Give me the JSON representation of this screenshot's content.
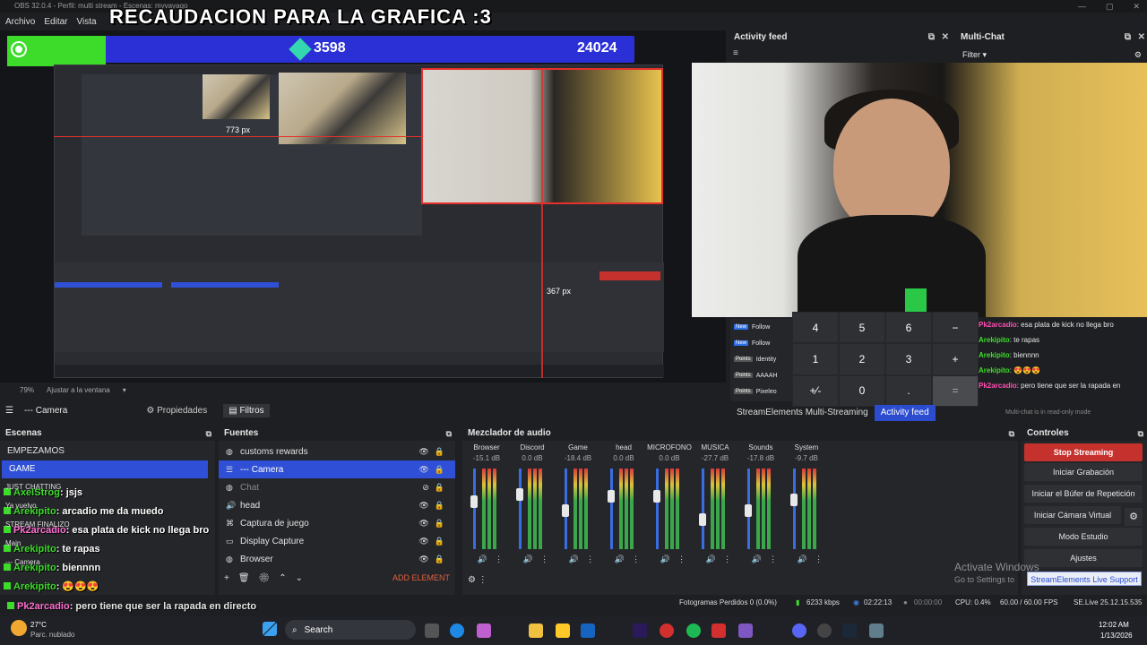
{
  "window": {
    "title": "OBS 32.0.4 - Perfil: multi stream - Escenas: myvayago",
    "btn_min": "—",
    "btn_max": "▢",
    "btn_close": "✕"
  },
  "menu": {
    "items": [
      "Archivo",
      "Editar",
      "Vista"
    ]
  },
  "overlay": {
    "title": "RECAUDACION PARA LA GRAFICA :3",
    "goal_current": "3598",
    "goal_target": "24024"
  },
  "preview": {
    "dim_width": "773 px",
    "dim_height": "367 px",
    "zoom": "79%",
    "fit_label": "Ajustar a la ventana"
  },
  "activity_feed": {
    "title": "Activity feed",
    "rows": [
      {
        "tag": "New",
        "label": "Follow"
      },
      {
        "tag": "New",
        "label": "Follow"
      },
      {
        "tag": "Points",
        "label": "Identity"
      },
      {
        "tag": "Points",
        "label": "AAAAH"
      },
      {
        "tag": "Points",
        "label": "Pixeleo"
      }
    ],
    "tabs": [
      "StreamElements Multi-Streaming",
      "Activity feed"
    ]
  },
  "multichat": {
    "title": "Multi-Chat",
    "filter": "Filter",
    "messages": [
      {
        "user": "Pk2arcadio",
        "text": "esa plata de kick no llega bro",
        "color": "p"
      },
      {
        "user": "Arekipito",
        "text": "te rapas",
        "color": "g"
      },
      {
        "user": "Arekipito",
        "text": "biennnn",
        "color": "g"
      },
      {
        "user": "Arekipito",
        "text": "😍😍😍",
        "color": "g"
      },
      {
        "user": "Pk2arcadio",
        "text": "pero tiene que ser la rapada en",
        "color": "p"
      }
    ],
    "readonly": "Multi-chat is in read-only mode"
  },
  "keypad": {
    "keys": [
      "4",
      "5",
      "6",
      "−",
      "1",
      "2",
      "3",
      "+",
      "+⁄-",
      "0",
      ".",
      "="
    ]
  },
  "source_bar": {
    "source": "--- Camera",
    "props": "Propiedades",
    "filters": "Filtros"
  },
  "scenes": {
    "title": "Escenas",
    "items": [
      "EMPEZAMOS",
      "GAME"
    ],
    "selected": 1,
    "hidden_scenes": [
      "JUST CHATTING",
      "Ya vuelvo",
      "STREAM FINALIZO",
      "Main",
      "--- Camera"
    ]
  },
  "scene_chat": [
    {
      "user": "AxelStrog",
      "text": ": jsjs",
      "color": "g"
    },
    {
      "user": "Arekipito",
      "text": ": arcadio me da muedo",
      "color": "g"
    },
    {
      "user": "Pk2arcadio",
      "text": ": esa plata de kick no llega bro",
      "color": "p"
    },
    {
      "user": "Arekipito",
      "text": ": te rapas",
      "color": "g"
    },
    {
      "user": "Arekipito",
      "text": ": biennnn",
      "color": "g"
    },
    {
      "user": "Arekipito",
      "text": ": 😍😍😍",
      "color": "g"
    }
  ],
  "bottom_chat": {
    "user": "Pk2arcadio",
    "text": ": pero tiene que ser la rapada en directo"
  },
  "sources": {
    "title": "Fuentes",
    "items": [
      {
        "label": "customs rewards",
        "icon": "globe-icon"
      },
      {
        "label": "--- Camera",
        "icon": "list-icon"
      },
      {
        "label": "Chat",
        "icon": "globe-icon"
      },
      {
        "label": "head",
        "icon": "speaker-icon"
      },
      {
        "label": "Captura de juego",
        "icon": "gamepad-icon"
      },
      {
        "label": "Display Capture",
        "icon": "monitor-icon"
      },
      {
        "label": "Browser",
        "icon": "globe-icon"
      }
    ],
    "selected": 1,
    "add_element": "ADD ELEMENT"
  },
  "mixer": {
    "title": "Mezclador de audio",
    "channels": [
      {
        "name": "Browser",
        "db": "-15.1 dB"
      },
      {
        "name": "Discord",
        "db": "0.0 dB"
      },
      {
        "name": "Game",
        "db": "-18.4 dB"
      },
      {
        "name": "head",
        "db": "0.0 dB"
      },
      {
        "name": "MICROFONO",
        "db": "0.0 dB"
      },
      {
        "name": "MUSICA",
        "db": "-27.7 dB"
      },
      {
        "name": "Sounds",
        "db": "-17.8 dB"
      },
      {
        "name": "System",
        "db": "-9.7 dB"
      }
    ]
  },
  "controls": {
    "title": "Controles",
    "stop_streaming": "Stop Streaming",
    "start_recording": "Iniciar Grabación",
    "replay_buffer": "Iniciar el Búfer de Repetición",
    "virtual_cam": "Iniciar Cámara Virtual",
    "studio_mode": "Modo Estudio",
    "settings": "Ajustes",
    "se_support": "StreamElements Live Support"
  },
  "activate_windows": {
    "title": "Activate Windows",
    "sub": "Go to Settings to"
  },
  "status": {
    "frames_dropped": "Fotogramas Perdidos 0 (0.0%)",
    "kbps": "6233 kbps",
    "stream_time": "02:22:13",
    "rec_time": "00:00:00",
    "cpu": "CPU: 0.4%",
    "fps": "60.00 / 60.00 FPS",
    "se_version": "SE.Live 25.12.15.535"
  },
  "taskbar": {
    "temp": "27°C",
    "weather": "Parc. nublado",
    "search": "Search",
    "time": "12:02 AM",
    "date": "1/13/2026"
  },
  "colors": {
    "accent": "#2f50d6",
    "stop": "#c5312d",
    "goal_bar": "#2b2fd6",
    "goal_fill": "#3ddc2a"
  }
}
